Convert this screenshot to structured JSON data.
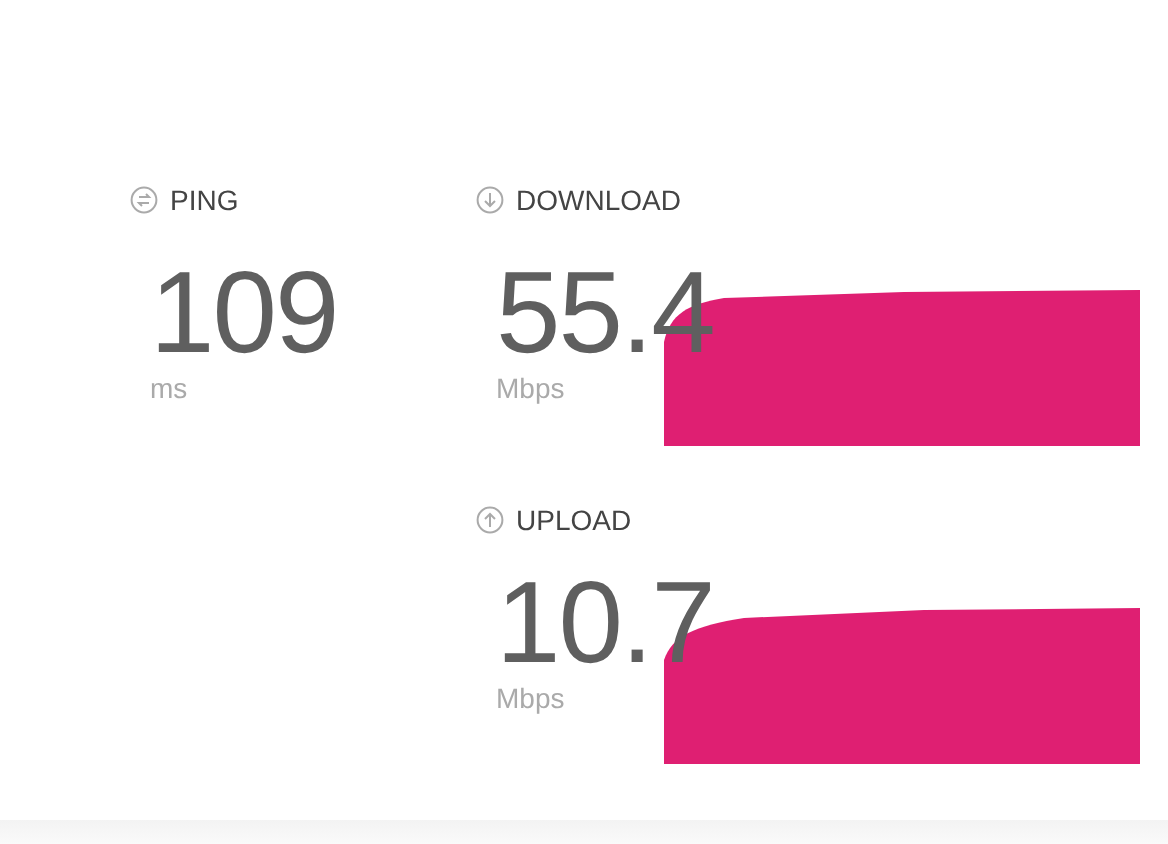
{
  "ping": {
    "label": "PING",
    "value": "109",
    "unit": "ms"
  },
  "transfers": [
    {
      "kind": "download",
      "label": "DOWNLOAD",
      "value": "55.4",
      "unit": "Mbps"
    },
    {
      "kind": "upload",
      "label": "UPLOAD",
      "value": "10.7",
      "unit": "Mbps"
    }
  ]
}
